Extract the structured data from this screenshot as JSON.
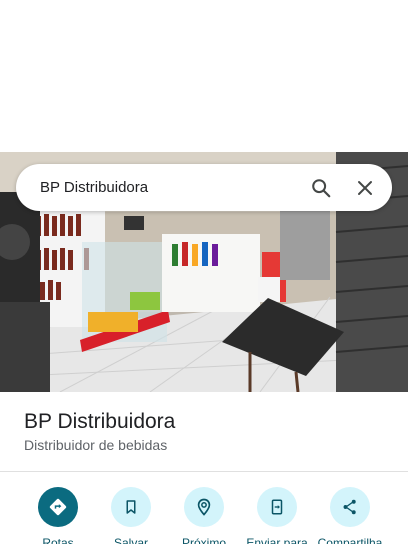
{
  "search": {
    "query": "BP Distribuidora"
  },
  "place": {
    "name": "BP Distribuidora",
    "category": "Distribuidor de bebidas"
  },
  "actions": [
    {
      "label": "Rotas",
      "icon": "directions-icon"
    },
    {
      "label": "Salvar",
      "icon": "bookmark-icon"
    },
    {
      "label": "Próximo",
      "icon": "nearby-icon"
    },
    {
      "label": "Enviar para",
      "icon": "send-to-phone-icon"
    },
    {
      "label": "Compartilha",
      "icon": "share-icon"
    }
  ],
  "colors": {
    "accent": "#0b6b80",
    "chip": "#d3f4fb",
    "label": "#0b5566"
  }
}
